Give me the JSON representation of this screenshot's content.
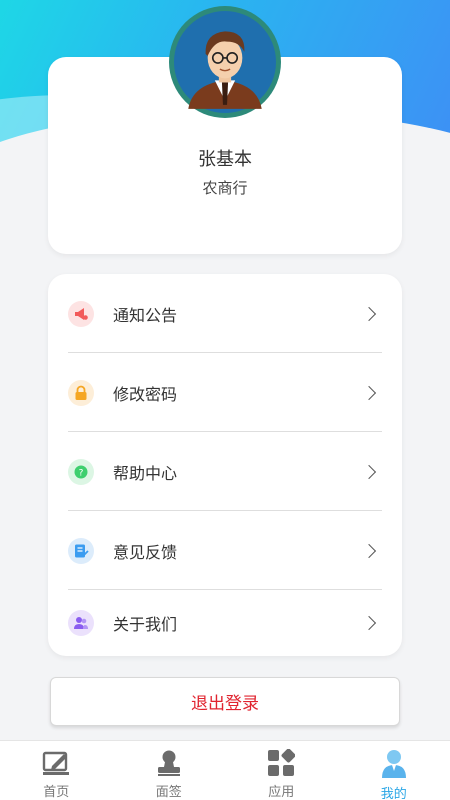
{
  "profile": {
    "name": "张基本",
    "organization": "农商行"
  },
  "menu": {
    "items": [
      {
        "label": "通知公告",
        "icon": "megaphone-icon",
        "color": "#f25a5a"
      },
      {
        "label": "修改密码",
        "icon": "lock-icon",
        "color": "#f5a623"
      },
      {
        "label": "帮助中心",
        "icon": "help-icon",
        "color": "#3ecf6e"
      },
      {
        "label": "意见反馈",
        "icon": "feedback-icon",
        "color": "#3b9cf0"
      },
      {
        "label": "关于我们",
        "icon": "users-icon",
        "color": "#8a5cf0"
      }
    ]
  },
  "logout_label": "退出登录",
  "tabbar": {
    "tabs": [
      {
        "label": "首页",
        "icon": "edit-icon"
      },
      {
        "label": "面签",
        "icon": "stamp-icon"
      },
      {
        "label": "应用",
        "icon": "apps-icon"
      },
      {
        "label": "我的",
        "icon": "user-icon",
        "active": true
      }
    ]
  },
  "colors": {
    "accent": "#2aa6e6",
    "logout": "#e0242f"
  }
}
